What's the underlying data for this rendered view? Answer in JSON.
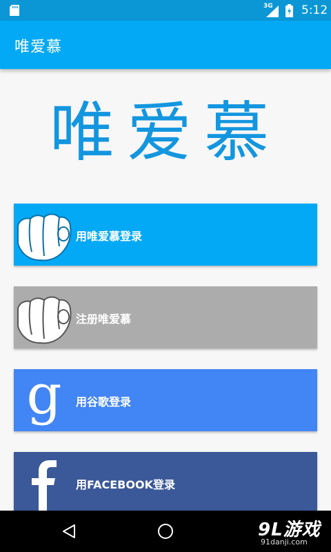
{
  "status_bar": {
    "network": "3G",
    "time": "5:12"
  },
  "app_bar": {
    "title": "唯爱慕"
  },
  "logo": {
    "text": "唯爱慕"
  },
  "buttons": [
    {
      "label": "用唯爱慕登录",
      "color": "#03a9f4",
      "icon": "pointing-fist-icon"
    },
    {
      "label": "注册唯爱慕",
      "color": "#acacac",
      "icon": "pointing-fist-icon"
    },
    {
      "label": "用谷歌登录",
      "color": "#4285f4",
      "icon": "google-g-icon"
    },
    {
      "label": "用FACEBOOK登录",
      "color": "#3b5998",
      "icon": "facebook-f-icon"
    }
  ],
  "watermark": {
    "main": "9L游戏",
    "sub": "91danji.com"
  }
}
